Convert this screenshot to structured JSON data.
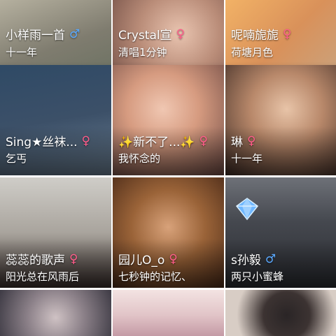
{
  "tiles": [
    {
      "name": "小样雨一首",
      "gender": "♂",
      "gender_type": "male",
      "subtitle": "十一年",
      "bg": "#8c8a7e"
    },
    {
      "name": "Crystal宣",
      "gender": "♀",
      "gender_type": "female",
      "subtitle": "清唱1分钟",
      "bg": "#c9a08d"
    },
    {
      "name": "呢喃旎旎",
      "gender": "♀",
      "gender_type": "female",
      "subtitle": "荷塘月色",
      "bg": "#d9a36a"
    },
    {
      "name": "Sing★丝袜...",
      "gender": "♀",
      "gender_type": "female",
      "subtitle": "乞丐",
      "bg": "#3b4f63"
    },
    {
      "name": "✨新不了...✨",
      "gender": "♀",
      "gender_type": "female",
      "subtitle": "我怀念的",
      "bg": "#c98a72"
    },
    {
      "name": "琳",
      "gender": "♀",
      "gender_type": "female",
      "subtitle": "十一年",
      "bg": "#9a6d57"
    },
    {
      "name": "蕊蕊的歌声",
      "gender": "♀",
      "gender_type": "female",
      "subtitle": "阳光总在风雨后",
      "bg": "#b8b6b0"
    },
    {
      "name": "园儿O_o",
      "gender": "♀",
      "gender_type": "female",
      "subtitle": "七秒钟的记忆、",
      "bg": "#8a5a34"
    },
    {
      "name": "s孙毅",
      "gender": "♂",
      "gender_type": "male",
      "subtitle": "两只小蜜蜂",
      "bg": "#4d5158"
    },
    {
      "name": "",
      "gender": "",
      "gender_type": "",
      "subtitle": "",
      "bg": "#6d6a70"
    },
    {
      "name": "",
      "gender": "",
      "gender_type": "",
      "subtitle": "",
      "bg": "#e0c6c9"
    },
    {
      "name": "",
      "gender": "",
      "gender_type": "",
      "subtitle": "",
      "bg": "#d7ccc4"
    }
  ]
}
